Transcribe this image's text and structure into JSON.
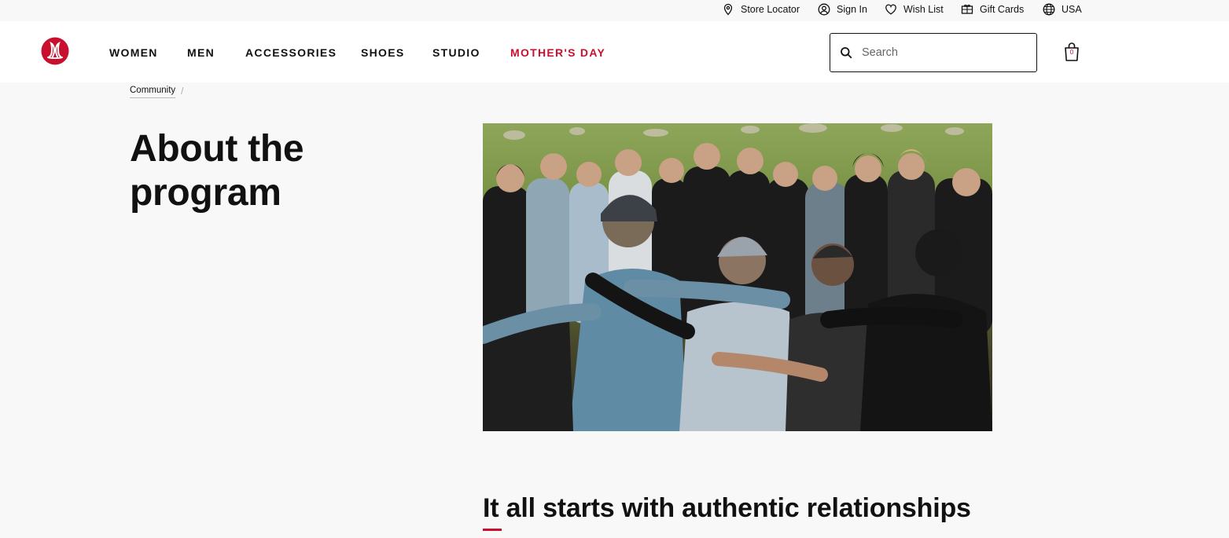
{
  "utility_bar": {
    "store_locator": "Store Locator",
    "sign_in": "Sign In",
    "wish_list": "Wish List",
    "gift_cards": "Gift Cards",
    "region": "USA"
  },
  "header": {
    "logo_icon": "lululemon-logo-icon",
    "nav": [
      {
        "label": "WOMEN"
      },
      {
        "label": "MEN"
      },
      {
        "label": "ACCESSORIES"
      },
      {
        "label": "SHOES"
      },
      {
        "label": "STUDIO"
      },
      {
        "label": "MOTHER'S DAY",
        "color": "#c8102e"
      }
    ],
    "search": {
      "placeholder": "Search",
      "value": ""
    },
    "bag": {
      "count": "0",
      "icon": "shopping-bag-icon"
    }
  },
  "breadcrumb": {
    "items": [
      {
        "label": "Community"
      }
    ],
    "separator": "/"
  },
  "main": {
    "title": "About the program",
    "hero_image": "group-hug-photo",
    "section_heading": "It all starts with authentic relationships"
  },
  "colors": {
    "accent": "#c8102e",
    "background": "#f8f8f8",
    "header_bg": "#ffffff",
    "text": "#111111"
  }
}
